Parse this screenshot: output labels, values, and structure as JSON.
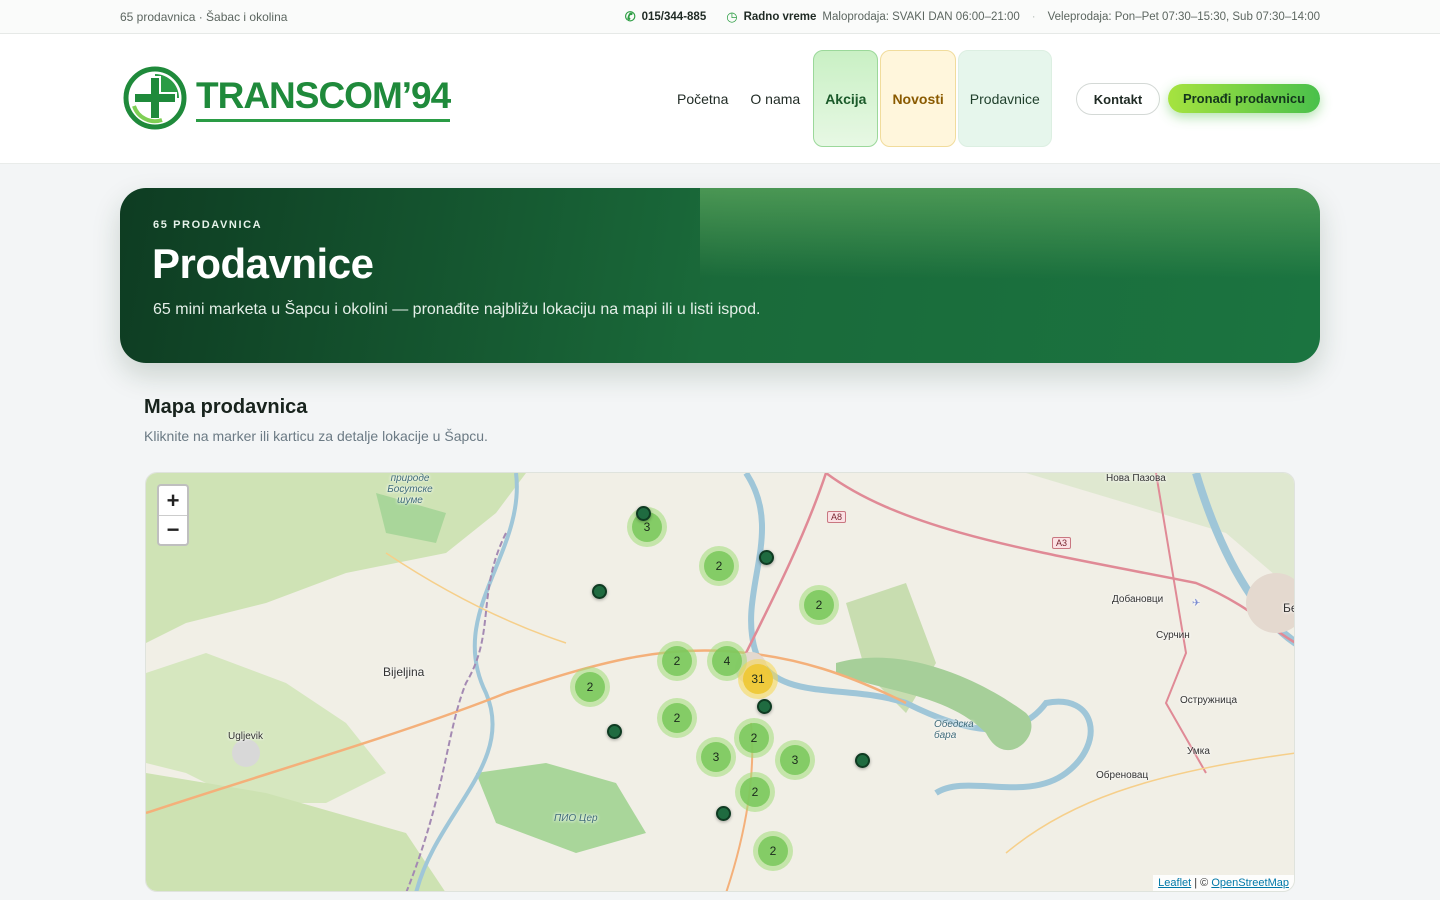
{
  "topbar": {
    "left_text": "65 prodavnica · Šabac i okolina",
    "phone": "015/344-885",
    "hours_label": "Radno vreme",
    "retail_hours": "Maloprodaja: SVAKI DAN 06:00–21:00",
    "wholesale_hours": "Veleprodaja: Pon–Pet 07:30–15:30, Sub 07:30–14:00"
  },
  "header": {
    "logo_text": "TRANSCOM’94",
    "nav": {
      "home": "Početna",
      "about": "O nama",
      "akcija": "Akcija",
      "novosti": "Novosti",
      "prodavnice": "Prodavnice"
    },
    "contact_button": "Kontakt",
    "find_button": "Pronađi prodavnicu"
  },
  "hero": {
    "eyebrow": "65 PRODAVNICA",
    "title": "Prodavnice",
    "subtitle": "65 mini marketa u Šapcu i okolini — pronađite najbližu lokaciju na mapi ili u listi ispod."
  },
  "map_section": {
    "title": "Mapa prodavnica",
    "subtitle": "Kliknite na marker ili karticu za detalje lokacije u Šapcu.",
    "zoom_in": "+",
    "zoom_out": "−",
    "clusters": [
      "3",
      "2",
      "2",
      "2",
      "4",
      "31",
      "2",
      "2",
      "2",
      "3",
      "3",
      "2",
      "2"
    ],
    "place_labels": {
      "bijeljina": "Bijeljina",
      "ugljevik": "Ugljevik",
      "nova_pazova": "Нова Пазова",
      "dobanovci": "Добановци",
      "surcin": "Сурчин",
      "ostruznica": "Остружница",
      "umka": "Умка",
      "obrenovac": "Обреновац",
      "obedska_bara": "Обедска бара",
      "pio_cer": "ПИО Цер",
      "bosutske_sume": "природе Босутске шуме",
      "be": "Бе",
      "a8": "A8",
      "a3": "A3"
    },
    "attribution": {
      "leaflet": "Leaflet",
      "separator": "| ©",
      "osm": "OpenStreetMap"
    }
  },
  "colors": {
    "brand_green": "#1f8a3b",
    "hero_dark": "#0e3c22",
    "cta_start": "#a6e33f",
    "cta_end": "#49c04b",
    "cluster_green": "#78c85a",
    "cluster_big": "#eec832",
    "pin": "#1f6b40"
  }
}
